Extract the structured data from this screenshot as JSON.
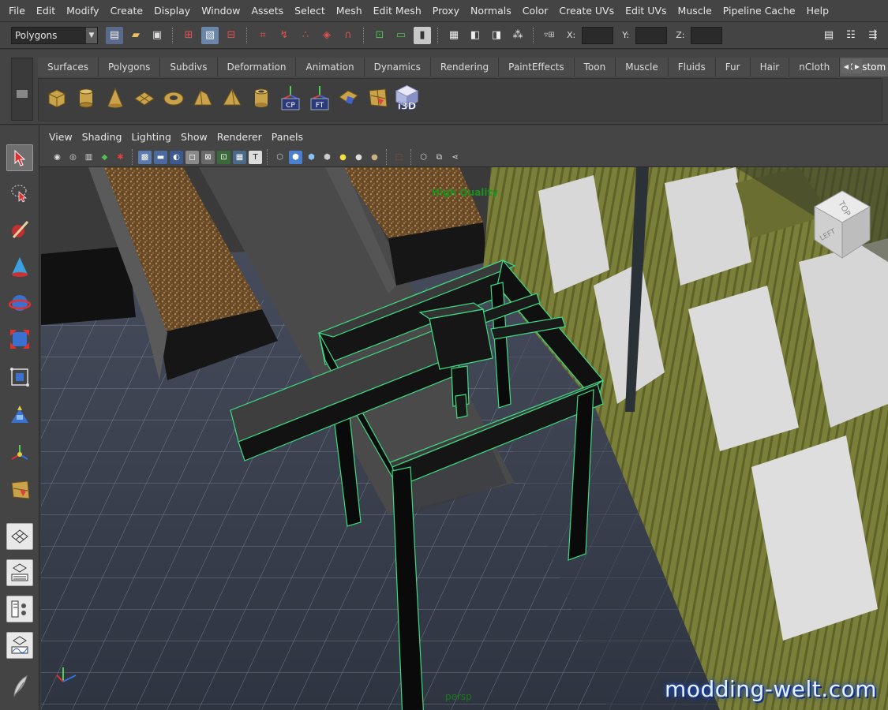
{
  "menubar": {
    "items": [
      "File",
      "Edit",
      "Modify",
      "Create",
      "Display",
      "Window",
      "Assets",
      "Select",
      "Mesh",
      "Edit Mesh",
      "Proxy",
      "Normals",
      "Color",
      "Create UVs",
      "Edit UVs",
      "Muscle",
      "Pipeline Cache",
      "Help"
    ]
  },
  "statusline": {
    "mode": "Polygons",
    "coord_labels": [
      "X:",
      "Y:",
      "Z:"
    ]
  },
  "shelf": {
    "tabs": [
      "Surfaces",
      "Polygons",
      "Subdivs",
      "Deformation",
      "Animation",
      "Dynamics",
      "Rendering",
      "PaintEffects",
      "Toon",
      "Muscle",
      "Fluids",
      "Fur",
      "Hair",
      "nCloth",
      "Custom"
    ],
    "active_tab": "Custom",
    "icon_labels": {
      "cp": "CP",
      "ft": "FT",
      "i3d": "i3D"
    }
  },
  "panel": {
    "menu": [
      "View",
      "Shading",
      "Lighting",
      "Show",
      "Renderer",
      "Panels"
    ]
  },
  "viewport": {
    "hud_quality": "High Quality",
    "camera_name": "persp",
    "viewcube": {
      "top": "TOP",
      "left": "LEFT"
    },
    "watermark": "modding-welt.com"
  },
  "colors": {
    "selection_wire": "#3ddc84",
    "hud_green": "#1f8f1f",
    "active_tab": "#5e5e5e"
  }
}
